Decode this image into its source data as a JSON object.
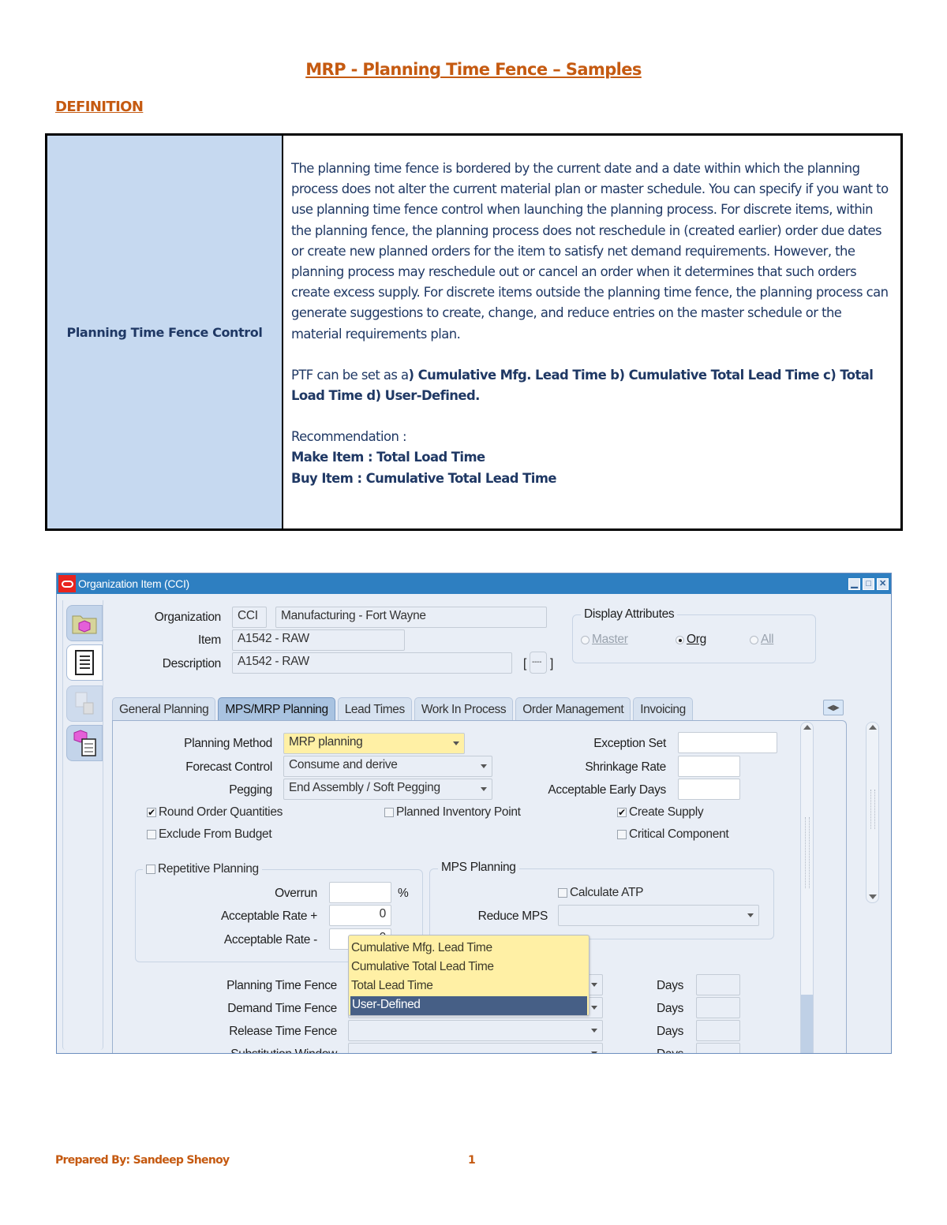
{
  "document": {
    "title": "MRP - Planning Time Fence – Samples",
    "section_heading": "DEFINITION",
    "definition_table": {
      "term": "Planning Time Fence Control",
      "description": "The planning time fence is bordered by the current date and a date within which the planning process does not alter the current material plan or master schedule. You can specify if you want to use planning time fence control when launching the planning process. For discrete items, within the planning fence, the planning process does not reschedule in (created earlier) order due dates or create new planned orders for the item to satisfy net demand requirements. However, the planning process may reschedule out or cancel an order when it determines that such orders create excess supply. For discrete items outside the planning time fence, the planning process can generate suggestions to create, change, and reduce entries on the master schedule or the material requirements plan.",
      "ptf_prefix": "PTF can be set as a",
      "ptf_options": ") Cumulative Mfg. Lead Time b) Cumulative Total Lead Time c) Total Load Time d) User-Defined.",
      "recommendation_label": "Recommendation :",
      "make_item": "Make Item  :  Total Load Time",
      "buy_item": "Buy Item : Cumulative Total Lead Time"
    },
    "footer": {
      "prepared_by": "Prepared By: Sandeep Shenoy",
      "page_number": "1"
    }
  },
  "window": {
    "title": "Organization Item (CCI)",
    "controls": {
      "minimize": "▁",
      "maximize": "□",
      "close": "✕"
    },
    "sidebar_icons": [
      "folder-item-icon",
      "list-icon",
      "organization-icon",
      "item-attributes-icon"
    ],
    "header": {
      "organization_label": "Organization",
      "organization_code": "CCI",
      "organization_name": "Manufacturing - Fort Wayne",
      "item_label": "Item",
      "item_value": "A1542 - RAW",
      "description_label": "Description",
      "description_value": "A1542 - RAW",
      "dff_button": "----",
      "dff_open": "[",
      "dff_close": "]"
    },
    "display_attributes": {
      "title": "Display Attributes",
      "options": [
        {
          "label": "Master",
          "selected": false,
          "enabled": false
        },
        {
          "label": "Org",
          "selected": true,
          "enabled": true
        },
        {
          "label": "All",
          "selected": false,
          "enabled": false
        }
      ]
    },
    "tabs": [
      {
        "label": "General Planning",
        "active": false
      },
      {
        "label": "MPS/MRP Planning",
        "active": true
      },
      {
        "label": "Lead Times",
        "active": false
      },
      {
        "label": "Work In Process",
        "active": false
      },
      {
        "label": "Order Management",
        "active": false
      },
      {
        "label": "Invoicing",
        "active": false
      }
    ],
    "mps_mrp": {
      "planning_method_label": "Planning Method",
      "planning_method_value": "MRP planning",
      "forecast_control_label": "Forecast Control",
      "forecast_control_value": "Consume and derive",
      "pegging_label": "Pegging",
      "pegging_value": "End Assembly / Soft Pegging",
      "exception_set_label": "Exception Set",
      "exception_set_value": "",
      "shrinkage_rate_label": "Shrinkage Rate",
      "shrinkage_rate_value": "",
      "acceptable_early_days_label": "Acceptable Early Days",
      "acceptable_early_days_value": "",
      "checkboxes": [
        {
          "label": "Round Order Quantities",
          "checked": true
        },
        {
          "label": "Planned Inventory Point",
          "checked": false
        },
        {
          "label": "Create Supply",
          "checked": true
        },
        {
          "label": "Exclude From Budget",
          "checked": false
        },
        {
          "label": "Critical Component",
          "checked": false
        }
      ],
      "repetitive_planning": {
        "label": "Repetitive Planning",
        "checked": false,
        "overrun_label": "Overrun",
        "overrun_value": "",
        "overrun_unit": "%",
        "rate_plus_label": "Acceptable Rate +",
        "rate_plus_value": "0",
        "rate_minus_label": "Acceptable Rate -",
        "rate_minus_value": "0"
      },
      "mps_planning": {
        "title": "MPS Planning",
        "calculate_atp_label": "Calculate ATP",
        "calculate_atp_checked": false,
        "reduce_mps_label": "Reduce MPS",
        "reduce_mps_value": ""
      },
      "time_fences": [
        {
          "label": "Planning Time Fence",
          "value": "",
          "days_label": "Days",
          "days_value": ""
        },
        {
          "label": "Demand Time Fence",
          "value": "",
          "days_label": "Days",
          "days_value": ""
        },
        {
          "label": "Release Time Fence",
          "value": "",
          "days_label": "Days",
          "days_value": ""
        },
        {
          "label": "Substitution Window",
          "value": "",
          "days_label": "Days",
          "days_value": ""
        }
      ],
      "ptf_dropdown_options": [
        {
          "label": "Cumulative Mfg. Lead Time",
          "selected": false
        },
        {
          "label": "Cumulative Total Lead Time",
          "selected": false
        },
        {
          "label": "Total Lead Time",
          "selected": false
        },
        {
          "label": "User-Defined",
          "selected": true
        }
      ]
    }
  }
}
